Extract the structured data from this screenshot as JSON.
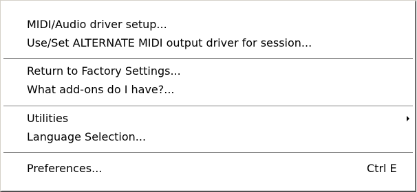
{
  "menu": {
    "groups": [
      {
        "items": [
          {
            "label": "MIDI/Audio driver setup..."
          },
          {
            "label": "Use/Set ALTERNATE MIDI output driver for session..."
          }
        ]
      },
      {
        "items": [
          {
            "label": "Return to Factory Settings..."
          },
          {
            "label": "What add-ons do I have?..."
          }
        ]
      },
      {
        "items": [
          {
            "label": "Utilities",
            "submenu_icon": "submenu-arrow-icon"
          },
          {
            "label": "Language Selection..."
          }
        ]
      },
      {
        "items": [
          {
            "label": "Preferences...",
            "shortcut": "Ctrl E"
          }
        ]
      }
    ]
  },
  "colors": {
    "background": "#ffffff",
    "text": "#000000",
    "separator_dark": "#808080"
  }
}
